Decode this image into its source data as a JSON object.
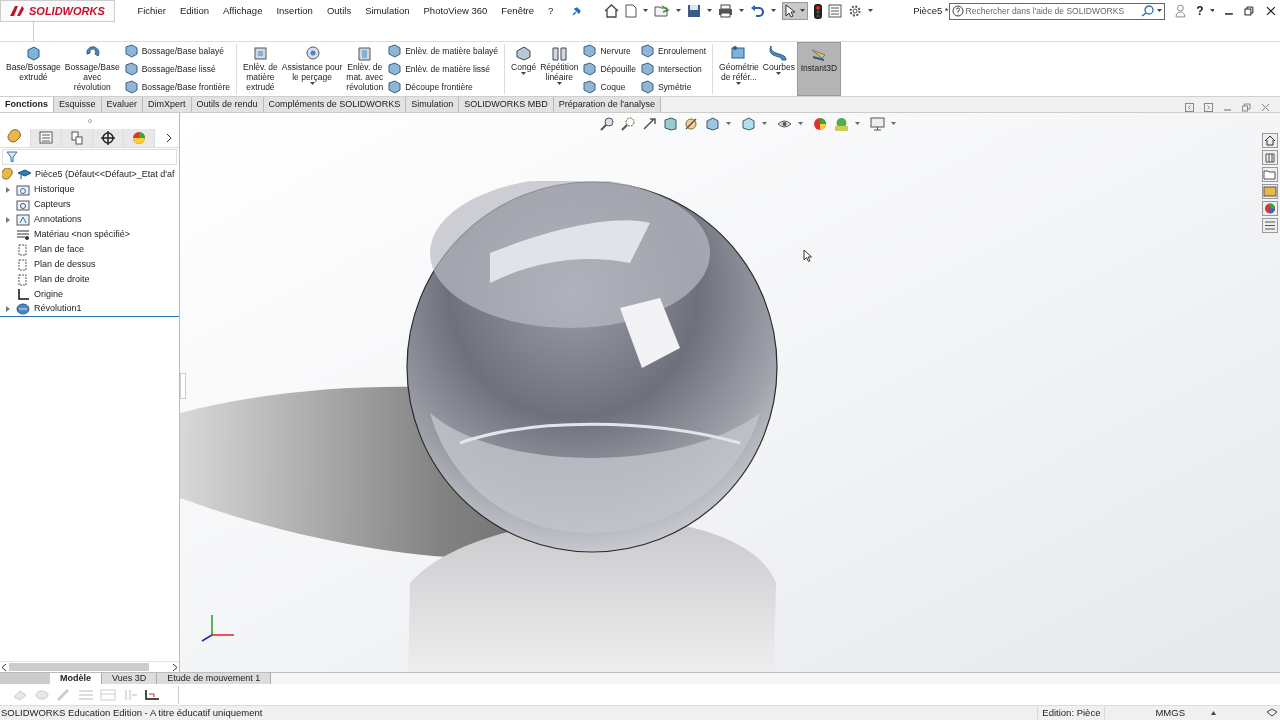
{
  "logo": {
    "text": "SOLIDWORKS"
  },
  "menu": [
    "Fichier",
    "Edition",
    "Affichage",
    "Insertion",
    "Outils",
    "Simulation",
    "PhotoView 360",
    "Fenêtre",
    "?"
  ],
  "select_tool": {
    "selected": true
  },
  "document_title": "Pièce5 *",
  "search": {
    "placeholder": "Rechercher dans l'aide de SOLIDWORKS"
  },
  "help_button": "?",
  "ribbon": [
    {
      "kind": "large",
      "label": "Base/Bossage\nextrudé",
      "dropdown": false,
      "selected": false
    },
    {
      "kind": "large",
      "label": "Bossage/Base\navec\nrévolution",
      "dropdown": false,
      "selected": false
    },
    {
      "kind": "stack",
      "items": [
        "Bossage/Base balayé",
        "Bossage/Base lissé",
        "Bossage/Base frontière"
      ]
    },
    {
      "kind": "separator"
    },
    {
      "kind": "large",
      "label": "Enlèv. de\nmatière\nextrudé",
      "dropdown": false,
      "selected": false
    },
    {
      "kind": "large",
      "label": "Assistance pour\nle perçage",
      "dropdown": true,
      "selected": false
    },
    {
      "kind": "large",
      "label": "Enlèv. de\nmat. avec\nrévolution",
      "dropdown": false,
      "selected": false
    },
    {
      "kind": "stack",
      "items": [
        "Enlèv. de matière balayé",
        "Enlèv. de matière lissé",
        "Découpe frontière"
      ]
    },
    {
      "kind": "separator"
    },
    {
      "kind": "large",
      "label": "Congé",
      "dropdown": true,
      "selected": false
    },
    {
      "kind": "large",
      "label": "Répétition\nlinéaire",
      "dropdown": true,
      "selected": false
    },
    {
      "kind": "stack",
      "items": [
        "Nervure",
        "Dépouille",
        "Coque"
      ]
    },
    {
      "kind": "stack",
      "items": [
        "Enroulement",
        "Intersection",
        "Symétrie"
      ]
    },
    {
      "kind": "separator"
    },
    {
      "kind": "large",
      "label": "Géométrie\nde référ...",
      "dropdown": true,
      "selected": false
    },
    {
      "kind": "large",
      "label": "Courbes",
      "dropdown": true,
      "selected": false
    },
    {
      "kind": "large",
      "label": "Instant3D",
      "dropdown": false,
      "selected": true
    }
  ],
  "command_tabs": [
    {
      "label": "Fonctions",
      "selected": true
    },
    {
      "label": "Esquisse",
      "selected": false
    },
    {
      "label": "Evaluer",
      "selected": false
    },
    {
      "label": "DimXpert",
      "selected": false
    },
    {
      "label": "Outils de rendu",
      "selected": false
    },
    {
      "label": "Compléments de SOLIDWORKS",
      "selected": false
    },
    {
      "label": "Simulation",
      "selected": false
    },
    {
      "label": "SOLIDWORKS MBD",
      "selected": false
    },
    {
      "label": "Préparation de l'analyse",
      "selected": false
    }
  ],
  "panel_tabs": [
    {
      "selected": true
    },
    {
      "selected": false
    },
    {
      "selected": false
    },
    {
      "selected": false
    },
    {
      "selected": false
    }
  ],
  "tree": {
    "label": "Pièce5  (Défaut<<Défaut>_Etat d'af",
    "children": [
      {
        "label": "Historique",
        "expandable": true,
        "selected": false
      },
      {
        "label": "Capteurs",
        "expandable": false,
        "selected": false
      },
      {
        "label": "Annotations",
        "expandable": true,
        "selected": false
      },
      {
        "label": "Matériau <non spécifié>",
        "expandable": false,
        "selected": false
      },
      {
        "label": "Plan de face",
        "expandable": false,
        "selected": false
      },
      {
        "label": "Plan de dessus",
        "expandable": false,
        "selected": false
      },
      {
        "label": "Plan de droite",
        "expandable": false,
        "selected": false
      },
      {
        "label": "Origine",
        "expandable": false,
        "selected": false
      },
      {
        "label": "Révolution1",
        "expandable": true,
        "selected": true
      }
    ]
  },
  "bottom_tabs": [
    {
      "label": "Modèle",
      "selected": true
    },
    {
      "label": "Vues 3D",
      "selected": false
    },
    {
      "label": "Etude de mouvement 1",
      "selected": false
    }
  ],
  "status_bar": {
    "message": "SOLIDWORKS Education Edition - A titre éducatif uniquement",
    "mode": "Edition: Pièce",
    "units": "MMGS"
  }
}
